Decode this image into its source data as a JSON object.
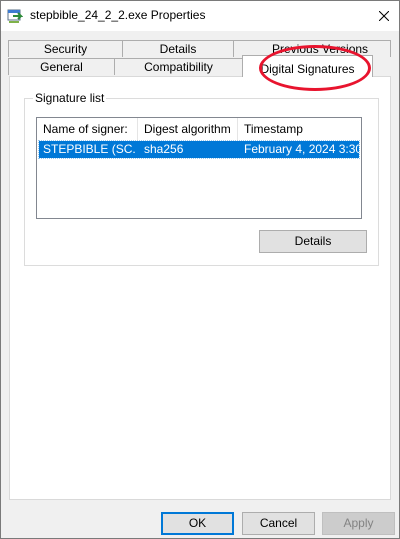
{
  "window": {
    "title": "stepbible_24_2_2.exe Properties"
  },
  "tabs": {
    "back_row": [
      "Security",
      "Details",
      "Previous Versions"
    ],
    "front_row": [
      "General",
      "Compatibility",
      "Digital Signatures"
    ],
    "active": "Digital Signatures"
  },
  "signature_list": {
    "label": "Signature list",
    "columns": [
      "Name of signer:",
      "Digest algorithm",
      "Timestamp"
    ],
    "rows": [
      {
        "signer": "STEPBIBLE (SC...",
        "digest": "sha256",
        "timestamp": "February 4, 2024 3:30..."
      }
    ]
  },
  "details_button": "Details",
  "footer": {
    "ok": "OK",
    "cancel": "Cancel",
    "apply": "Apply"
  },
  "colors": {
    "selection": "#0078d7",
    "annotation": "#e8142e"
  }
}
